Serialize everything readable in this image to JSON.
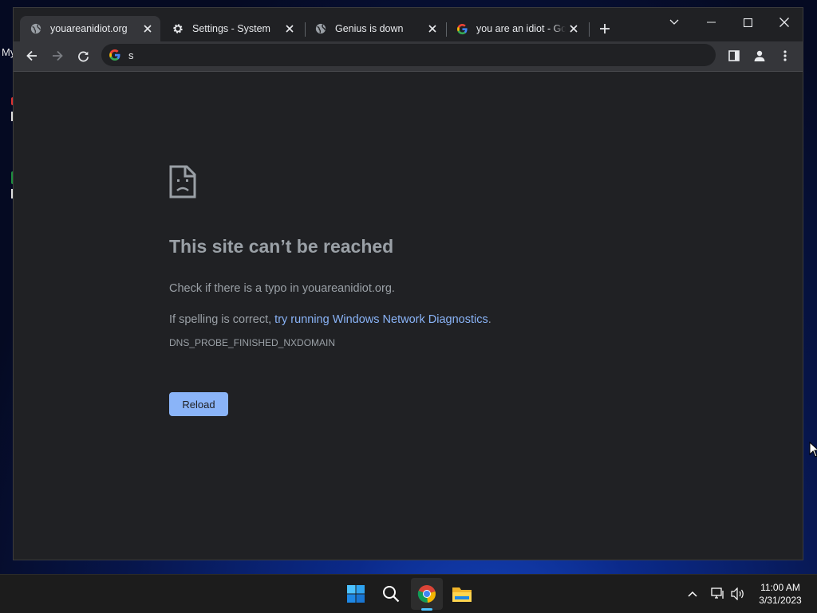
{
  "desktop": {
    "label": "My"
  },
  "tabs": [
    {
      "title": "youareanidiot.org",
      "icon": "globe-icon",
      "active": true
    },
    {
      "title": "Settings - System",
      "icon": "gear-icon",
      "active": false
    },
    {
      "title": "Genius is down",
      "icon": "globe-icon",
      "active": false
    },
    {
      "title": "you are an idiot - Go",
      "icon": "google-icon",
      "active": false
    }
  ],
  "omnibox": {
    "value": "s"
  },
  "error": {
    "title": "This site can’t be reached",
    "check_text": "Check if there is a typo in youareanidiot.org.",
    "spelling_prefix": "If spelling is correct, ",
    "diagnostics_link": "try running Windows Network Diagnostics",
    "spelling_suffix": ".",
    "code": "DNS_PROBE_FINISHED_NXDOMAIN",
    "reload_label": "Reload"
  },
  "taskbar": {
    "time": "11:00 AM",
    "date": "3/31/2023",
    "apps": [
      "windows-start-icon",
      "search-icon",
      "chrome-icon",
      "file-explorer-icon"
    ]
  },
  "colors": {
    "page_bg": "#202124",
    "toolbar_bg": "#35363a",
    "link": "#8ab4f8",
    "text_muted": "#9aa0a6",
    "taskbar_accent": "#4cc2ff"
  }
}
